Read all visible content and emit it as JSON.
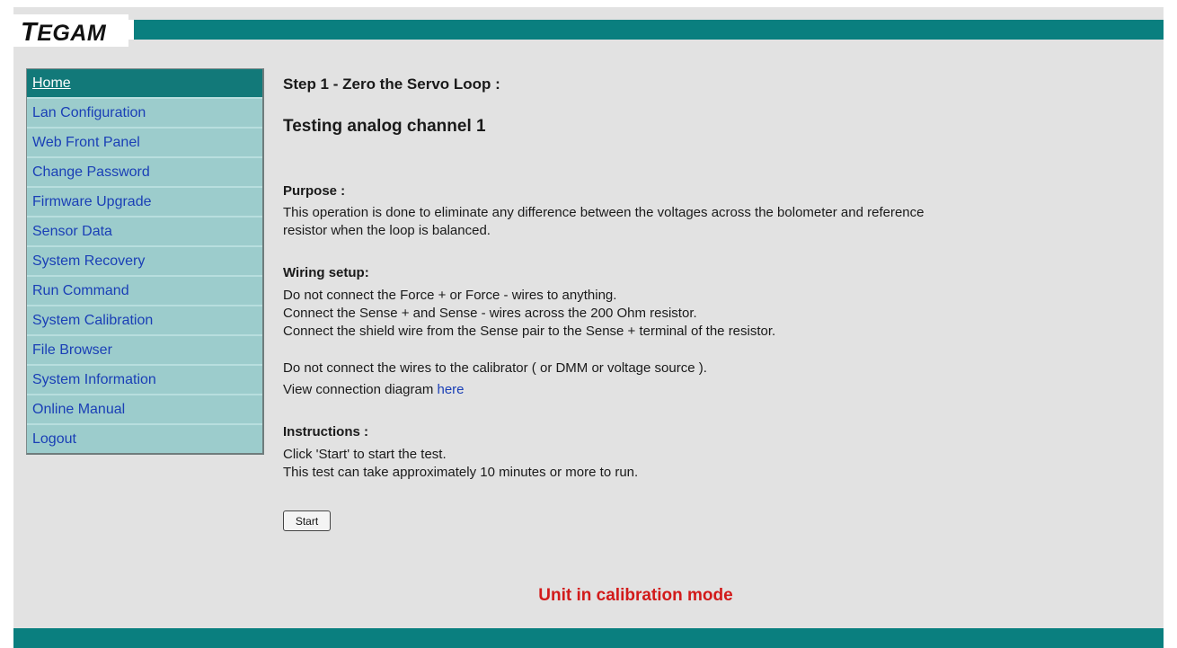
{
  "logo": {
    "text": "TEGAM"
  },
  "sidebar": {
    "items": [
      {
        "label": "Home"
      },
      {
        "label": "Lan Configuration"
      },
      {
        "label": "Web Front Panel"
      },
      {
        "label": "Change Password"
      },
      {
        "label": "Firmware Upgrade"
      },
      {
        "label": "Sensor Data"
      },
      {
        "label": "System Recovery"
      },
      {
        "label": "Run Command"
      },
      {
        "label": "System Calibration"
      },
      {
        "label": "File Browser"
      },
      {
        "label": "System Information"
      },
      {
        "label": "Online Manual"
      },
      {
        "label": "Logout"
      }
    ],
    "active_index": 0
  },
  "main": {
    "step_title": "Step 1 - Zero the Servo Loop :",
    "test_title": "Testing analog channel 1",
    "purpose": {
      "title": "Purpose :",
      "lines": [
        "This operation is done to eliminate any difference between the voltages across the bolometer and reference",
        "resistor when the loop is balanced."
      ]
    },
    "wiring": {
      "title": "Wiring setup:",
      "lines": [
        "Do not connect the Force + or Force - wires to anything.",
        "Connect the Sense + and Sense - wires across the 200 Ohm resistor.",
        "Connect the shield wire from the Sense pair to the Sense + terminal of the resistor."
      ],
      "note": "Do not connect the wires to the calibrator ( or DMM or voltage source ).",
      "diagram_prefix": "View connection diagram ",
      "diagram_link": "here"
    },
    "instructions": {
      "title": "Instructions :",
      "lines": [
        "Click 'Start' to start the test.",
        "This test can take approximately 10 minutes or more to run."
      ]
    },
    "start_button": "Start",
    "status": "Unit in calibration mode"
  },
  "colors": {
    "teal_bar": "#0a7f7f",
    "nav_bg": "#9ccccc",
    "nav_active": "#127979",
    "link": "#1a3fb6",
    "status_red": "#d21a1a"
  }
}
